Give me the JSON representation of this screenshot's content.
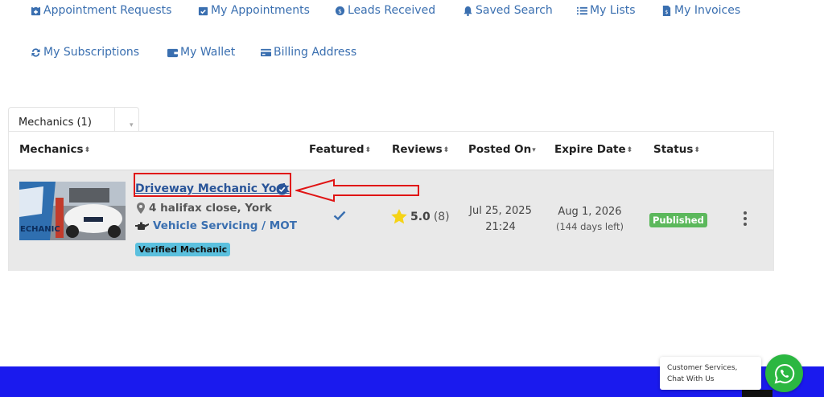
{
  "nav": {
    "row1": [
      {
        "label": "Appointment Requests",
        "icon": "calendar-plus-icon"
      },
      {
        "label": "My Appointments",
        "icon": "calendar-check-icon"
      },
      {
        "label": "Leads Received",
        "icon": "chat-dollar-icon"
      },
      {
        "label": "Saved Search",
        "icon": "bell-icon"
      },
      {
        "label": "My Lists",
        "icon": "list-icon"
      },
      {
        "label": "My Invoices",
        "icon": "invoice-icon"
      }
    ],
    "row2": [
      {
        "label": "My Subscriptions",
        "icon": "refresh-icon"
      },
      {
        "label": "My Wallet",
        "icon": "wallet-icon"
      },
      {
        "label": "Billing Address",
        "icon": "credit-card-icon"
      }
    ]
  },
  "tab": {
    "label": "Mechanics (1)"
  },
  "table": {
    "columns": {
      "mechanics": "Mechanics",
      "featured": "Featured",
      "reviews": "Reviews",
      "posted_on": "Posted On",
      "expire_date": "Expire Date",
      "status": "Status"
    },
    "row": {
      "title": "Driveway Mechanic York",
      "location": "4 halifax close, York",
      "category": "Vehicle Servicing / MOT",
      "badge": "Verified Mechanic",
      "featured": true,
      "rating": "5.0",
      "review_count": "(8)",
      "posted_date": "Jul 25, 2025",
      "posted_time": "21:24",
      "expire_date": "Aug 1, 2026",
      "days_left": "(144 days left)",
      "status": "Published",
      "thumbnail_text": "ECHANIC"
    }
  },
  "chat": {
    "text": "Customer Services, Chat With Us"
  },
  "colors": {
    "link": "#3a6fb0",
    "published": "#5cb85c",
    "verified_badge": "#5bc0de",
    "annotation_red": "#e01414",
    "footer": "#1a1aee",
    "whatsapp": "#2bb741"
  }
}
